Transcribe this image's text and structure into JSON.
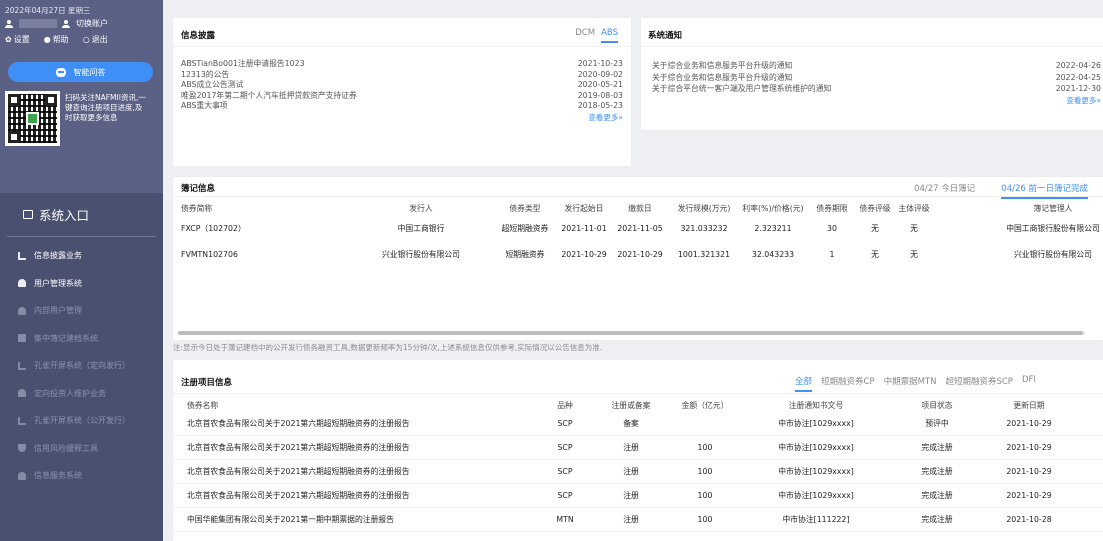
{
  "sidebar": {
    "date": "2022年04月27日 星期三",
    "switch_account": "切换账户",
    "settings": "设置",
    "help": "帮助",
    "logout": "退出",
    "ai_button": "智能问答",
    "qr_text": "扫码关注NAFMII资讯,一键查询注册项目进度,及时获取更多信息",
    "system_entry": "系统入口",
    "nav": [
      {
        "label": "信息披露业务",
        "icon": "chart-icon",
        "active": true
      },
      {
        "label": "用户管理系统",
        "icon": "user-icon",
        "active": true
      },
      {
        "label": "内部用户管理",
        "icon": "users-icon",
        "active": false
      },
      {
        "label": "集中簿记建档系统",
        "icon": "list-icon",
        "active": false
      },
      {
        "label": "孔雀开屏系统（定向发行）",
        "icon": "peacock-icon",
        "active": false
      },
      {
        "label": "定向投资人维护业务",
        "icon": "user-icon",
        "active": false
      },
      {
        "label": "孔雀开屏系统（公开发行）",
        "icon": "peacock-icon",
        "active": false
      },
      {
        "label": "信用风险缓释工具",
        "icon": "shield-icon",
        "active": false
      },
      {
        "label": "信息服务系统",
        "icon": "globe-icon",
        "active": false
      }
    ]
  },
  "disclosure": {
    "title": "信息披露",
    "tabs": [
      "DCM",
      "ABS"
    ],
    "active_tab": "ABS",
    "items": [
      {
        "text": "ABSTianBo001注册申请报告1023",
        "date": "2021-10-23"
      },
      {
        "text": "12313的公告",
        "date": "2020-09-02"
      },
      {
        "text": "ABS成立公告测试",
        "date": "2020-05-21"
      },
      {
        "text": "唯盈2017年第二期个人汽车抵押贷款资产支持证券",
        "date": "2019-08-03"
      },
      {
        "text": "ABS重大事项",
        "date": "2018-05-23"
      }
    ],
    "more": "查看更多»"
  },
  "system_notice": {
    "title": "系统通知",
    "items": [
      {
        "text": "关于综合业务和信息服务平台升级的通知",
        "date": "2022-04-26"
      },
      {
        "text": "关于综合业务和信息服务平台升级的通知",
        "date": "2022-04-25"
      },
      {
        "text": "关于综合平台统一客户端及用户管理系统维护的通知",
        "date": "2021-12-30"
      }
    ],
    "more": "查看更多»"
  },
  "bookkeeping": {
    "title": "簿记信息",
    "tabs": [
      "04/27 今日簿记",
      "04/26 前一日簿记完成"
    ],
    "active_tab": "04/26 前一日簿记完成",
    "columns": [
      "债券简称",
      "发行人",
      "债券类型",
      "发行起始日",
      "缴款日",
      "发行规模(万元)",
      "利率(%)/价格(元)",
      "债券期限",
      "债券评级",
      "主体评级",
      "簿记管理人"
    ],
    "rows": [
      [
        "FXCP（102702）",
        "中国工商银行",
        "超短期融资券",
        "2021-11-01",
        "2021-11-05",
        "321.033232",
        "2.323211",
        "30",
        "无",
        "无",
        "中国工商银行股份有限公司"
      ],
      [
        "FVMTN102706",
        "兴业银行股份有限公司",
        "短期融资券",
        "2021-10-29",
        "2021-10-29",
        "1001.321321",
        "32.043233",
        "1",
        "无",
        "无",
        "兴业银行股份有限公司"
      ]
    ],
    "notice": "注:显示今日处于簿记建档中的公开发行债务融资工具,数据更新频率为15分钟/次,上述系统信息仅供参考,实际情况以公告信息为准."
  },
  "registration": {
    "title": "注册项目信息",
    "tabs": [
      "全部",
      "短期融资券CP",
      "中期票据MTN",
      "超短期融资券SCP",
      "DFI"
    ],
    "active_tab": "全部",
    "columns": [
      "债券名称",
      "品种",
      "注册或备案",
      "金额（亿元）",
      "注册通知书文号",
      "项目状态",
      "更新日期"
    ],
    "rows": [
      [
        "北京首农食品有限公司关于2021第六期超短期融资券的注册报告",
        "SCP",
        "备案",
        "",
        "中市协注[1029xxxx]",
        "预评中",
        "2021-10-29"
      ],
      [
        "北京首农食品有限公司关于2021第六期超短期融资券的注册报告",
        "SCP",
        "注册",
        "100",
        "中市协注[1029xxxx]",
        "完成注册",
        "2021-10-29"
      ],
      [
        "北京首农食品有限公司关于2021第六期超短期融资券的注册报告",
        "SCP",
        "注册",
        "100",
        "中市协注[1029xxxx]",
        "完成注册",
        "2021-10-29"
      ],
      [
        "北京首农食品有限公司关于2021第六期超短期融资券的注册报告",
        "SCP",
        "注册",
        "100",
        "中市协注[1029xxxx]",
        "完成注册",
        "2021-10-29"
      ],
      [
        "中国华能集团有限公司关于2021第一期中期票据的注册报告",
        "MTN",
        "注册",
        "100",
        "中市协注[111222]",
        "完成注册",
        "2021-10-28"
      ]
    ]
  },
  "colors": {
    "accent": "#3f8ff7",
    "sidebar": "#4a5170",
    "sidebar_top": "#5b6085"
  }
}
